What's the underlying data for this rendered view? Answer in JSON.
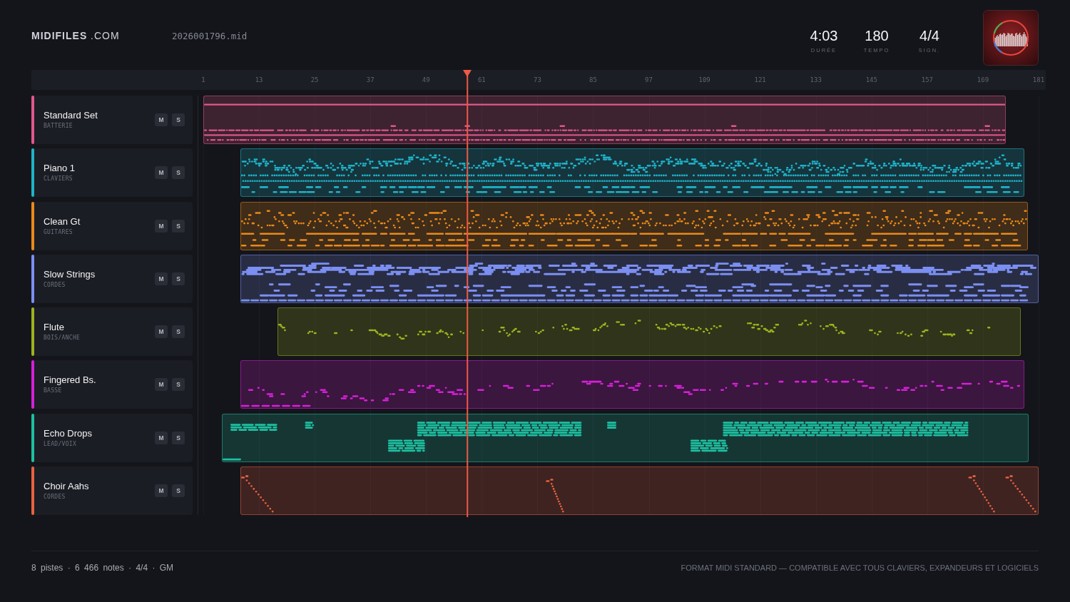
{
  "header": {
    "logo": "**MIDIFILES** .COM",
    "filename": "2026001796.mid",
    "stats": [
      {
        "value": "4:03",
        "label": "DURÉE"
      },
      {
        "value": "180",
        "label": "TEMPO"
      },
      {
        "value": "4/4",
        "label": "SIGN."
      }
    ]
  },
  "ruler": {
    "ticks": [
      "1",
      "13",
      "25",
      "37",
      "49",
      "61",
      "73",
      "85",
      "97",
      "109",
      "121",
      "133",
      "145",
      "157",
      "169",
      "181"
    ]
  },
  "playhead": {
    "level": 0.316
  },
  "tracks": [
    {
      "name": "Standard Set",
      "category": "BATTERIE",
      "color": "#e0588c",
      "kind": "drums",
      "mute": "M",
      "solo": "S"
    },
    {
      "name": "Piano 1",
      "category": "CLAVIERS",
      "color": "#1fb3c9",
      "kind": "keys",
      "mute": "M",
      "solo": "S"
    },
    {
      "name": "Clean Gt",
      "category": "GUITARES",
      "color": "#e98a1b",
      "kind": "guitar",
      "mute": "M",
      "solo": "S"
    },
    {
      "name": "Slow Strings",
      "category": "CORDES",
      "color": "#7b8ff2",
      "kind": "pad",
      "mute": "M",
      "solo": "S"
    },
    {
      "name": "Flute",
      "category": "BOIS/ANCHE",
      "color": "#9db31f",
      "kind": "lead",
      "mute": "M",
      "solo": "S"
    },
    {
      "name": "Fingered Bs.",
      "category": "BASSE",
      "color": "#d520d8",
      "kind": "bass",
      "mute": "M",
      "solo": "S"
    },
    {
      "name": "Echo Drops",
      "category": "LEAD/VOIX",
      "color": "#1ec0a0",
      "kind": "chords",
      "mute": "M",
      "solo": "S"
    },
    {
      "name": "Choir Aahs",
      "category": "CORDES",
      "color": "#e8613f",
      "kind": "choir",
      "mute": "M",
      "solo": "S"
    }
  ],
  "footer": {
    "summary": "8 pistes · 6 466 notes · 4/4 · GM",
    "note": "FORMAT MIDI STANDARD — COMPATIBLE AVEC TOUS CLAVIERS, EXPANDEURS ET LOGICIELS"
  }
}
